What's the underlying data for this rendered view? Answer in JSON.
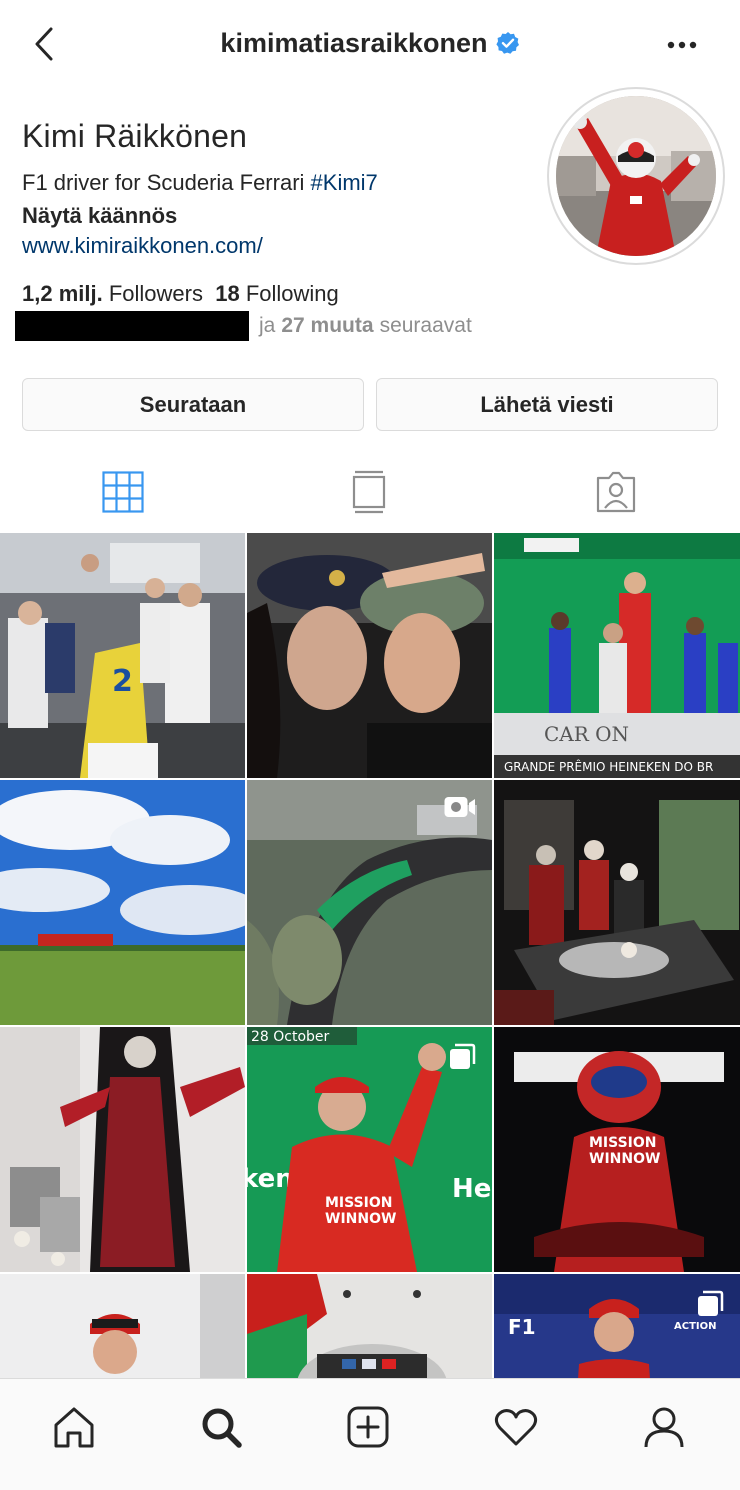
{
  "header": {
    "username": "kimimatiasraikkonen",
    "back_icon": "chevron-left-icon",
    "verified_icon": "verified-badge-icon",
    "more_icon": "more-horizontal-icon"
  },
  "profile": {
    "display_name": "Kimi Räikkönen",
    "bio_text": "F1 driver for Scuderia Ferrari ",
    "bio_hashtag": "#Kimi7",
    "translate_label": "Näytä käännös",
    "website": "www.kimiraikkonen.com/",
    "followers_count": "1,2 milj.",
    "followers_label": "Followers",
    "following_count": "18",
    "following_label": "Following",
    "mutual_prefix": "ja",
    "mutual_count": "27 muuta",
    "mutual_suffix": "seuraavat"
  },
  "actions": {
    "follow_label": "Seurataan",
    "message_label": "Lähetä viesti"
  },
  "tabs": [
    {
      "name": "grid-icon",
      "active": true
    },
    {
      "name": "igtv-icon",
      "active": false
    },
    {
      "name": "tagged-icon",
      "active": false
    }
  ],
  "grid_badges": {
    "video": "video-camera-icon",
    "carousel": "carousel-icon"
  },
  "bottom_nav": [
    {
      "name": "home-icon"
    },
    {
      "name": "search-icon",
      "active": true
    },
    {
      "name": "new-post-icon"
    },
    {
      "name": "activity-heart-icon"
    },
    {
      "name": "profile-icon"
    }
  ],
  "colors": {
    "text": "#262626",
    "link": "#00376b",
    "muted": "#8e8e8e",
    "accent_tab": "#3897f0",
    "verified": "#3897f0",
    "border": "#dbdbdb"
  }
}
